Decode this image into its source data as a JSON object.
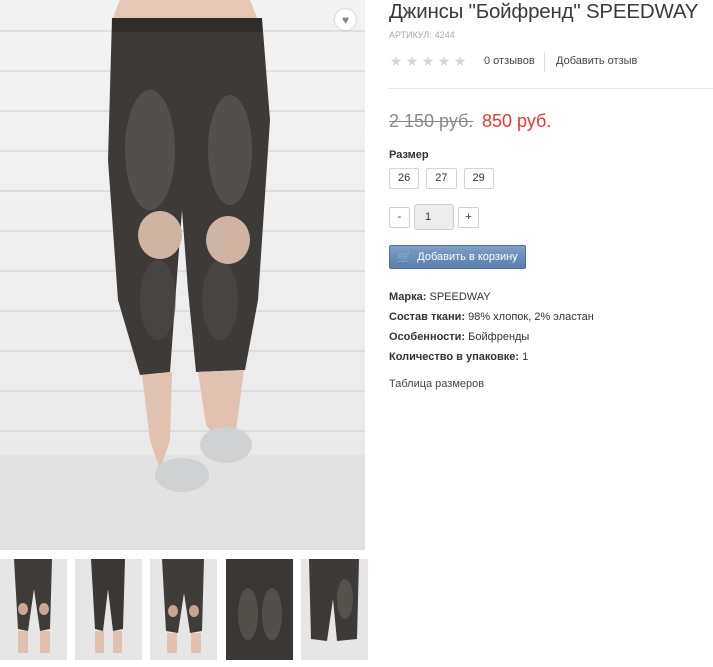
{
  "product": {
    "title": "Джинсы \"Бойфренд\" SPEEDWAY",
    "sku_label": "АРТИКУЛ:",
    "sku_value": "4244",
    "rating": 0,
    "reviews_count": "0 отзывов",
    "add_review": "Добавить отзыв",
    "old_price": "2 150 руб.",
    "new_price": "850 руб.",
    "size_label": "Размер",
    "sizes": [
      "26",
      "27",
      "29"
    ],
    "qty_minus": "-",
    "qty_value": "1",
    "qty_plus": "+",
    "add_to_cart": "Добавить в корзину",
    "size_table_link": "Таблица размеров",
    "specs": [
      {
        "label": "Марка:",
        "value": "SPEEDWAY"
      },
      {
        "label": "Состав ткани:",
        "value": "98% хлопок, 2% эластан"
      },
      {
        "label": "Особенности:",
        "value": "Бойфренды"
      },
      {
        "label": "Количество в упаковке:",
        "value": "1"
      }
    ]
  },
  "gallery": {
    "wishlist_icon": "heart-icon",
    "thumbnail_count": 5
  },
  "colors": {
    "price_new": "#e53935",
    "price_old": "#8a8a8a",
    "cart_button": "#6a8dba",
    "denim": "#3d3a38"
  }
}
